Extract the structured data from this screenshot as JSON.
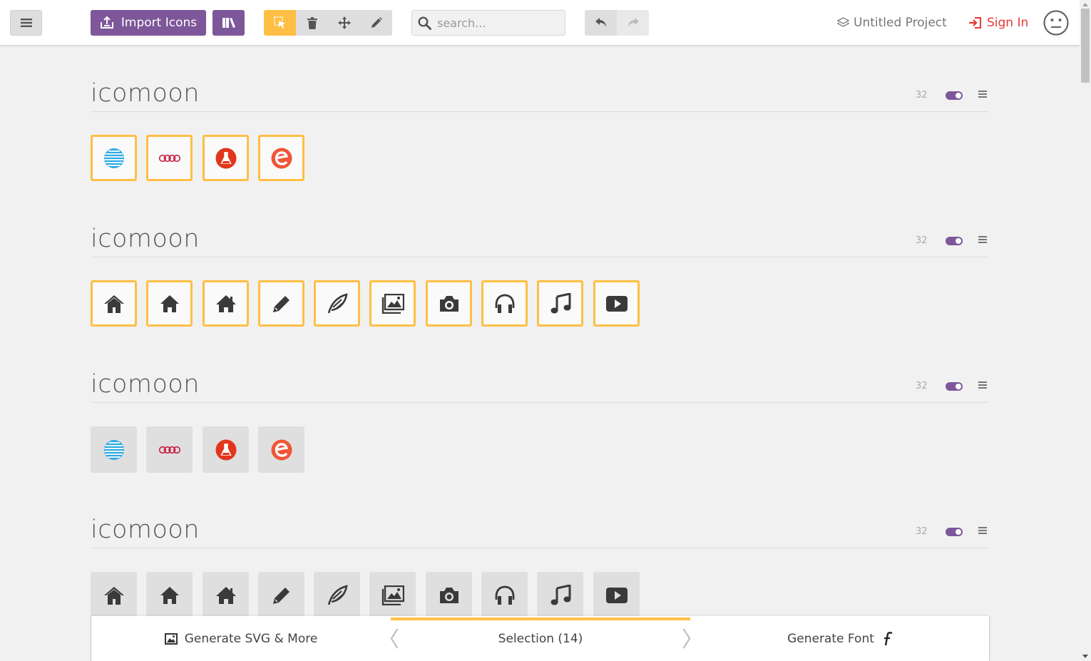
{
  "toolbar": {
    "menu_icon": "hamburger-icon",
    "import_label": "Import Icons",
    "search_placeholder": "search...",
    "project_name": "Untitled Project",
    "signin_label": "Sign In"
  },
  "colors": {
    "purple": "#7d5799",
    "accent": "#ffbf45",
    "signin": "#e53935"
  },
  "sets": [
    {
      "title": "icomoon",
      "size": "32",
      "selected": true,
      "icons": [
        "att-icon",
        "audi-icon",
        "lab-icon",
        "eventbrite-icon"
      ]
    },
    {
      "title": "icomoon",
      "size": "32",
      "selected": true,
      "icons": [
        "home-icon",
        "home2-icon",
        "home3-icon",
        "pencil-icon",
        "quill-icon",
        "images-icon",
        "camera-icon",
        "headphones-icon",
        "music-icon",
        "play-icon"
      ]
    },
    {
      "title": "icomoon",
      "size": "32",
      "selected": false,
      "icons": [
        "att-icon",
        "audi-icon",
        "lab-icon",
        "eventbrite-icon"
      ]
    },
    {
      "title": "icomoon",
      "size": "32",
      "selected": false,
      "icons": [
        "home-icon",
        "home2-icon",
        "home3-icon",
        "pencil-icon",
        "quill-icon",
        "images-icon",
        "camera-icon",
        "headphones-icon",
        "music-icon",
        "play-icon"
      ]
    }
  ],
  "bottombar": {
    "svg_label": "Generate SVG & More",
    "selection_label": "Selection (14)",
    "font_label": "Generate Font"
  }
}
